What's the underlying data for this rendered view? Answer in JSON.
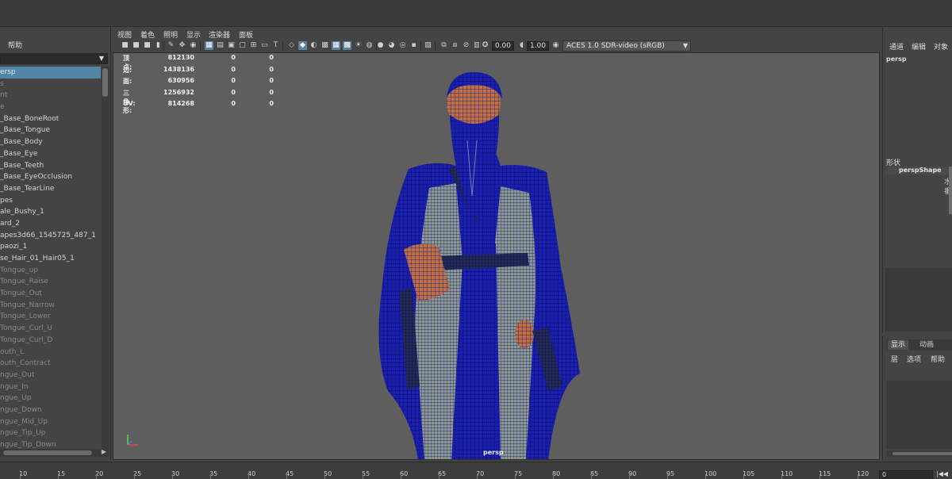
{
  "outliner": {
    "menu_help": "帮助",
    "items": [
      {
        "label": "ersp",
        "style": "sel"
      },
      {
        "label": "s",
        "style": "dim"
      },
      {
        "label": "nt",
        "style": "dim"
      },
      {
        "label": "e",
        "style": "dim"
      },
      {
        "label": "_Base_BoneRoot",
        "style": ""
      },
      {
        "label": "_Base_Tongue",
        "style": ""
      },
      {
        "label": "_Base_Body",
        "style": ""
      },
      {
        "label": "_Base_Eye",
        "style": ""
      },
      {
        "label": "_Base_Teeth",
        "style": ""
      },
      {
        "label": "_Base_EyeOcclusion",
        "style": ""
      },
      {
        "label": "_Base_TearLine",
        "style": ""
      },
      {
        "label": "pes",
        "style": ""
      },
      {
        "label": "ale_Bushy_1",
        "style": ""
      },
      {
        "label": "ard_2",
        "style": ""
      },
      {
        "label": "apes3d66_1545725_487_1",
        "style": ""
      },
      {
        "label": "paozi_1",
        "style": ""
      },
      {
        "label": "se_Hair_01_Hair05_1",
        "style": ""
      },
      {
        "label": "Tongue_up",
        "style": "dim"
      },
      {
        "label": "Tongue_Raise",
        "style": "dim"
      },
      {
        "label": "Tongue_Out",
        "style": "dim"
      },
      {
        "label": "Tongue_Narrow",
        "style": "dim"
      },
      {
        "label": "Tongue_Lower",
        "style": "dim"
      },
      {
        "label": "Tongue_Curl_U",
        "style": "dim"
      },
      {
        "label": "Tongue_Curl_D",
        "style": "dim"
      },
      {
        "label": "outh_L",
        "style": "dim"
      },
      {
        "label": "outh_Contract",
        "style": "dim"
      },
      {
        "label": "ngue_Out",
        "style": "dim"
      },
      {
        "label": "ngue_In",
        "style": "dim"
      },
      {
        "label": "ngue_Up",
        "style": "dim"
      },
      {
        "label": "ngue_Down",
        "style": "dim"
      },
      {
        "label": "ngue_Mid_Up",
        "style": "dim"
      },
      {
        "label": "ngue_Tip_Up",
        "style": "dim"
      },
      {
        "label": "ngue_Tip_Down",
        "style": "dim"
      }
    ]
  },
  "viewport": {
    "menus": [
      "视图",
      "着色",
      "照明",
      "显示",
      "渲染器",
      "面板"
    ],
    "exposure": "0.00",
    "gamma": "1.00",
    "color_space": "ACES 1.0 SDR-video (sRGB)",
    "camera_label": "persp",
    "hud": [
      {
        "label": "顶点:",
        "v1": "812130",
        "v2": "0",
        "v3": "0"
      },
      {
        "label": "边:",
        "v1": "1438136",
        "v2": "0",
        "v3": "0"
      },
      {
        "label": "面:",
        "v1": "630956",
        "v2": "0",
        "v3": "0"
      },
      {
        "label": "三角形:",
        "v1": "1256932",
        "v2": "0",
        "v3": "0"
      },
      {
        "label": "UV:",
        "v1": "814268",
        "v2": "0",
        "v3": "0"
      }
    ]
  },
  "channel_box": {
    "tabs": [
      "通道",
      "编辑",
      "对象"
    ],
    "object": "persp",
    "shapes_header": "形状",
    "shape": "perspShape",
    "right_chars": [
      "水",
      "番"
    ]
  },
  "layers": {
    "tabs": [
      "显示",
      "动画"
    ],
    "menus": [
      "层",
      "选项",
      "帮助"
    ]
  },
  "timeline": {
    "ticks": [
      "10",
      "15",
      "20",
      "25",
      "30",
      "35",
      "40",
      "45",
      "50",
      "55",
      "60",
      "65",
      "70",
      "75",
      "80",
      "85",
      "90",
      "95",
      "100",
      "105",
      "110",
      "115",
      "120"
    ],
    "current_frame": "0"
  },
  "colors": {
    "mesh_wire": "#1a1aa8",
    "skin_wire": "#c07040",
    "robe_light": "#8e9a8c",
    "selection": "#5285a6"
  }
}
